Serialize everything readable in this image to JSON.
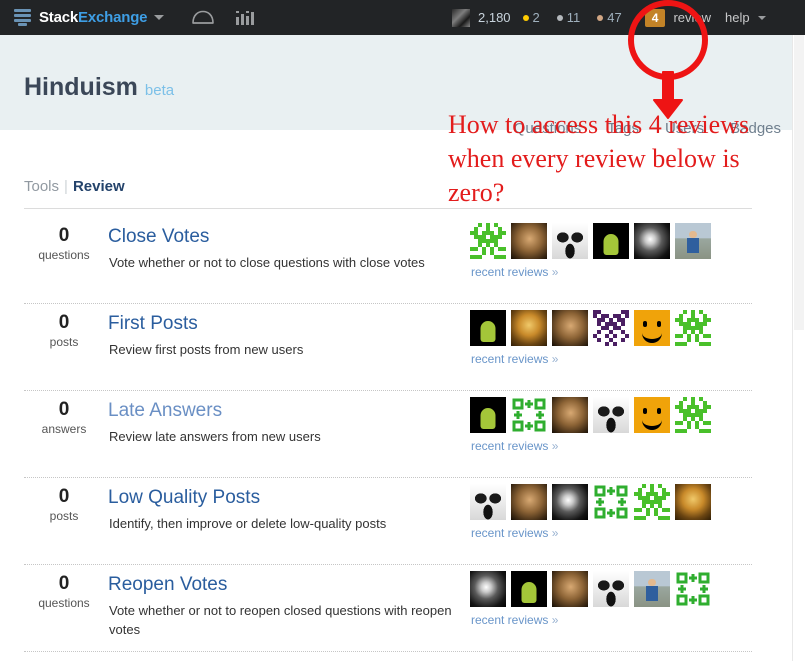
{
  "topbar": {
    "logo_icon": "stack-exchange-logo-icon",
    "wordmark_1": "Stack",
    "wordmark_2": "Exchange",
    "site_switcher_caret": "chevron-down-icon",
    "inbox_icon": "inbox-icon",
    "achievements_icon": "achievements-chart-icon",
    "reputation": "2,180",
    "gold_badges": "2",
    "silver_badges": "11",
    "bronze_badges": "47",
    "review_badge_count": "4",
    "review_label": "review",
    "help_label": "help",
    "badge_color_gold": "#ffcc01",
    "badge_color_silver": "#b4b8bc",
    "badge_color_bronze": "#d1a684",
    "review_badge_color": "#c38327",
    "bar_color": "#222426"
  },
  "siteheader": {
    "title": "Hinduism",
    "beta": "beta",
    "background": "#e9f0f2",
    "nav": [
      "Questions",
      "Tags",
      "Users",
      "Badges"
    ]
  },
  "toolsbar": {
    "tools_label": "Tools",
    "separator": "|",
    "review_label": "Review"
  },
  "annotation": {
    "text": "How to access this 4 reviews when every review below is zero?",
    "color": "#e31c1c",
    "circle_target": "review-badge",
    "shapes": [
      "circle",
      "down-arrow"
    ]
  },
  "reviews": [
    {
      "count": "0",
      "unit": "questions",
      "title": "Close Votes",
      "visited": false,
      "description": "Vote whether or not to close questions with close votes",
      "recent_link": "recent reviews",
      "chevron": "»",
      "avatars": [
        "green-identicon",
        "photo-man",
        "photo-wolf",
        "android-logo",
        "bw-swirl",
        "person-street"
      ]
    },
    {
      "count": "0",
      "unit": "posts",
      "title": "First Posts",
      "visited": false,
      "description": "Review first posts from new users",
      "recent_link": "recent reviews",
      "chevron": "»",
      "avatars": [
        "android-logo",
        "photo-ganesha",
        "photo-man",
        "purple-identicon",
        "smiley-face",
        "green-identicon"
      ]
    },
    {
      "count": "0",
      "unit": "answers",
      "title": "Late Answers",
      "visited": true,
      "description": "Review late answers from new users",
      "recent_link": "recent reviews",
      "chevron": "»",
      "avatars": [
        "android-logo",
        "green-arrow-identicon",
        "photo-man",
        "photo-wolf",
        "smiley-face",
        "green-identicon"
      ]
    },
    {
      "count": "0",
      "unit": "posts",
      "title": "Low Quality Posts",
      "visited": false,
      "description": "Identify, then improve or delete low-quality posts",
      "recent_link": "recent reviews",
      "chevron": "»",
      "avatars": [
        "photo-wolf",
        "photo-man",
        "bw-swirl",
        "green-arrow-identicon",
        "green-identicon",
        "photo-ganesha"
      ]
    },
    {
      "count": "0",
      "unit": "questions",
      "title": "Reopen Votes",
      "visited": false,
      "description": "Vote whether or not to reopen closed questions with reopen votes",
      "recent_link": "recent reviews",
      "chevron": "»",
      "avatars": [
        "bw-swirl",
        "android-logo",
        "photo-man",
        "photo-wolf",
        "person-street",
        "green-arrow-identicon"
      ]
    }
  ]
}
